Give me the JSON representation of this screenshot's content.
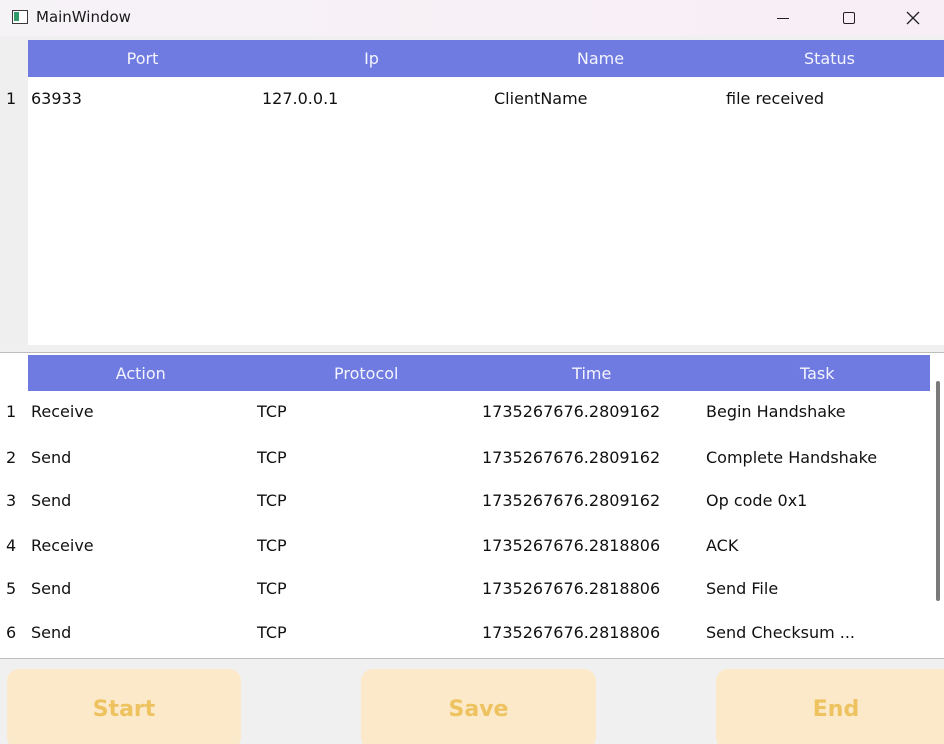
{
  "window": {
    "title": "MainWindow"
  },
  "clients_table": {
    "columns": [
      "Port",
      "Ip",
      "Name",
      "Status"
    ],
    "rows": [
      {
        "num": "1",
        "port": "63933",
        "ip": "127.0.0.1",
        "name": "ClientName",
        "status": "file received"
      }
    ]
  },
  "log_table": {
    "columns": [
      "Action",
      "Protocol",
      "Time",
      "Task"
    ],
    "rows": [
      {
        "num": "1",
        "action": "Receive",
        "protocol": "TCP",
        "time": "1735267676.2809162",
        "task": "Begin Handshake"
      },
      {
        "num": "2",
        "action": "Send",
        "protocol": "TCP",
        "time": "1735267676.2809162",
        "task": "Complete Handshake"
      },
      {
        "num": "3",
        "action": "Send",
        "protocol": "TCP",
        "time": "1735267676.2809162",
        "task": "Op code 0x1"
      },
      {
        "num": "4",
        "action": "Receive",
        "protocol": "TCP",
        "time": "1735267676.2818806",
        "task": "ACK"
      },
      {
        "num": "5",
        "action": "Send",
        "protocol": "TCP",
        "time": "1735267676.2818806",
        "task": "Send File"
      },
      {
        "num": "6",
        "action": "Send",
        "protocol": "TCP",
        "time": "1735267676.2818806",
        "task": "Send Checksum ..."
      }
    ]
  },
  "buttons": {
    "start": "Start",
    "save": "Save",
    "end": "End"
  },
  "colors": {
    "header_bg": "#6f7be0",
    "button_bg": "#fbe9c9",
    "button_text": "#eec25f"
  },
  "icons": {
    "app": "app-window-icon",
    "minimize": "minimize-icon",
    "maximize": "maximize-icon",
    "close": "close-icon"
  }
}
